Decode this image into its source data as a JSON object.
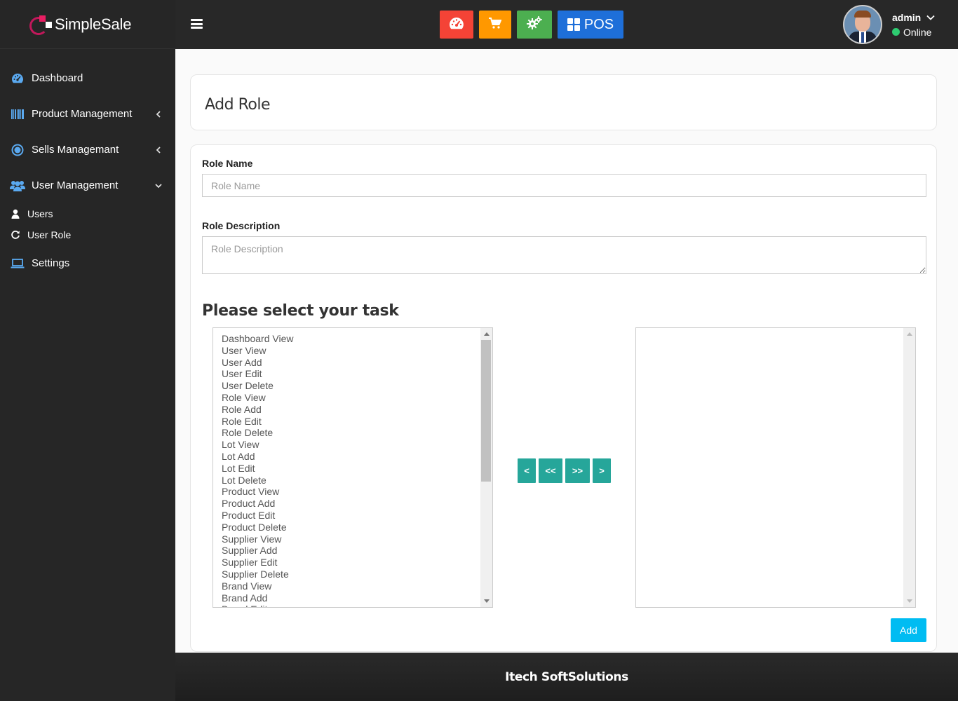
{
  "brand": {
    "name_bold": "Simple",
    "name_light": "Sale"
  },
  "sidebar": {
    "items": [
      {
        "label": "Dashboard"
      },
      {
        "label": "Product Management"
      },
      {
        "label": "Sells Managemant"
      },
      {
        "label": "User Management"
      }
    ],
    "sub_items": [
      {
        "label": "Users"
      },
      {
        "label": "User Role"
      }
    ],
    "settings": {
      "label": "Settings"
    }
  },
  "topbar": {
    "pos_label": "POS",
    "user": {
      "name": "admin",
      "status": "Online",
      "status_color": "#2ecc71"
    }
  },
  "page": {
    "title": "Add Role"
  },
  "form": {
    "role_name": {
      "label": "Role Name",
      "placeholder": "Role Name",
      "value": ""
    },
    "role_description": {
      "label": "Role Description",
      "placeholder": "Role Description",
      "value": ""
    },
    "task_title": "Please select your task",
    "available_tasks": [
      "Dashboard View",
      "User View",
      "User Add",
      "User Edit",
      "User Delete",
      "Role View",
      "Role Add",
      "Role Edit",
      "Role Delete",
      "Lot View",
      "Lot Add",
      "Lot Edit",
      "Lot Delete",
      "Product View",
      "Product Add",
      "Product Edit",
      "Product Delete",
      "Supplier View",
      "Supplier Add",
      "Supplier Edit",
      "Supplier Delete",
      "Brand View",
      "Brand Add",
      "Brand Edit"
    ],
    "selected_tasks": [],
    "move_buttons": {
      "move_left": "<",
      "move_all_left": "<<",
      "move_all_right": ">>",
      "move_right": ">"
    },
    "submit_label": "Add"
  },
  "footer": {
    "text": "Itech SoftSolutions"
  },
  "colors": {
    "sidebar_bg": "#262626",
    "topbar_bg": "#282828",
    "dashboard_btn": "#f44336",
    "cart_btn": "#ff9800",
    "settings_btn": "#4caf50",
    "pos_btn": "#1e6fd9",
    "move_btn": "#26a69a",
    "add_btn": "#00bcf2",
    "icon_blue": "#5aa9f0"
  },
  "icons": {
    "dashboard": "speedometer-icon",
    "cart": "cart-icon",
    "gear": "gears-icon",
    "pos": "grid-icon",
    "product": "barcode-icon",
    "sells": "circle-dot-icon",
    "users_group": "users-icon",
    "user": "user-icon",
    "role": "refresh-icon",
    "settings": "laptop-icon"
  }
}
